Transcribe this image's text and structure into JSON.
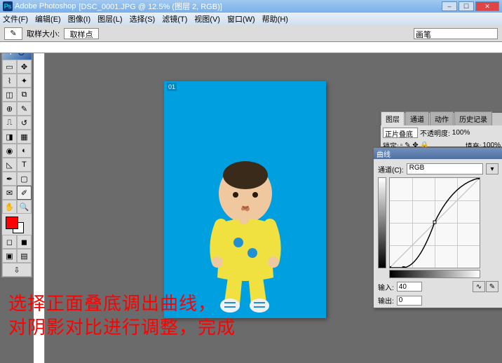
{
  "title": {
    "app": "Adobe Photoshop",
    "doc": "[DSC_0001.JPG @ 12.5% (图层 2, RGB)]"
  },
  "menu": {
    "file": "文件(F)",
    "edit": "编辑(E)",
    "image": "图像(I)",
    "layer": "图层(L)",
    "select": "选择(S)",
    "filter": "滤镜(T)",
    "view": "视图(V)",
    "window": "窗口(W)",
    "help": "帮助(H)"
  },
  "optbar": {
    "sample_label": "取样大小:",
    "sample_value": "取样点",
    "brush_label": "画笔"
  },
  "doc": {
    "meta": "01"
  },
  "layers": {
    "tab1": "图层",
    "tab2": "通道",
    "tab3": "动作",
    "tab4": "历史记录",
    "blend": "正片叠底",
    "opacity_label": "不透明度:",
    "opacity": "100%",
    "lock_label": "锁定:",
    "fill_label": "填充:",
    "fill": "100%"
  },
  "curves": {
    "title": "曲线",
    "channel_label": "通道(C):",
    "channel": "RGB",
    "input_label": "输入:",
    "input": "40",
    "output_label": "输出:",
    "output": "0"
  },
  "overlay": {
    "line1": "选择正面叠底调出曲线，",
    "line2": "对阴影对比进行调整，完成"
  },
  "chart_data": {
    "type": "line",
    "title": "Curves",
    "xlabel": "Input",
    "ylabel": "Output",
    "xlim": [
      0,
      255
    ],
    "ylim": [
      0,
      255
    ],
    "series": [
      {
        "name": "RGB",
        "values": [
          [
            0,
            0
          ],
          [
            40,
            0
          ],
          [
            80,
            40
          ],
          [
            128,
            130
          ],
          [
            180,
            210
          ],
          [
            255,
            255
          ]
        ]
      }
    ]
  }
}
